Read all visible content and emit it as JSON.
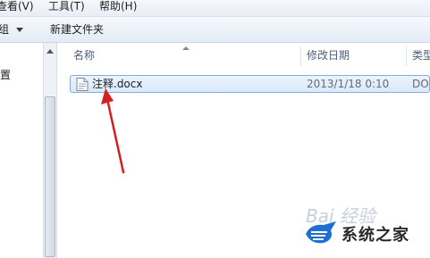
{
  "menubar": {
    "view": "查看(V)",
    "tools": "工具(T)",
    "help": "帮助(H)"
  },
  "toolbar": {
    "organize": "组",
    "new_folder": "新建文件夹"
  },
  "nav": {
    "item": "置"
  },
  "columns": {
    "name": "名称",
    "modified": "修改日期",
    "type": "类型"
  },
  "files": [
    {
      "name": "注释.docx",
      "modified": "2013/1/18 0:10",
      "type": "DO"
    }
  ],
  "watermark": {
    "brand": "系统之家",
    "faint": "Bai 经验"
  },
  "colors": {
    "annotation_arrow": "#d42020",
    "selection_border": "#84acdd"
  }
}
